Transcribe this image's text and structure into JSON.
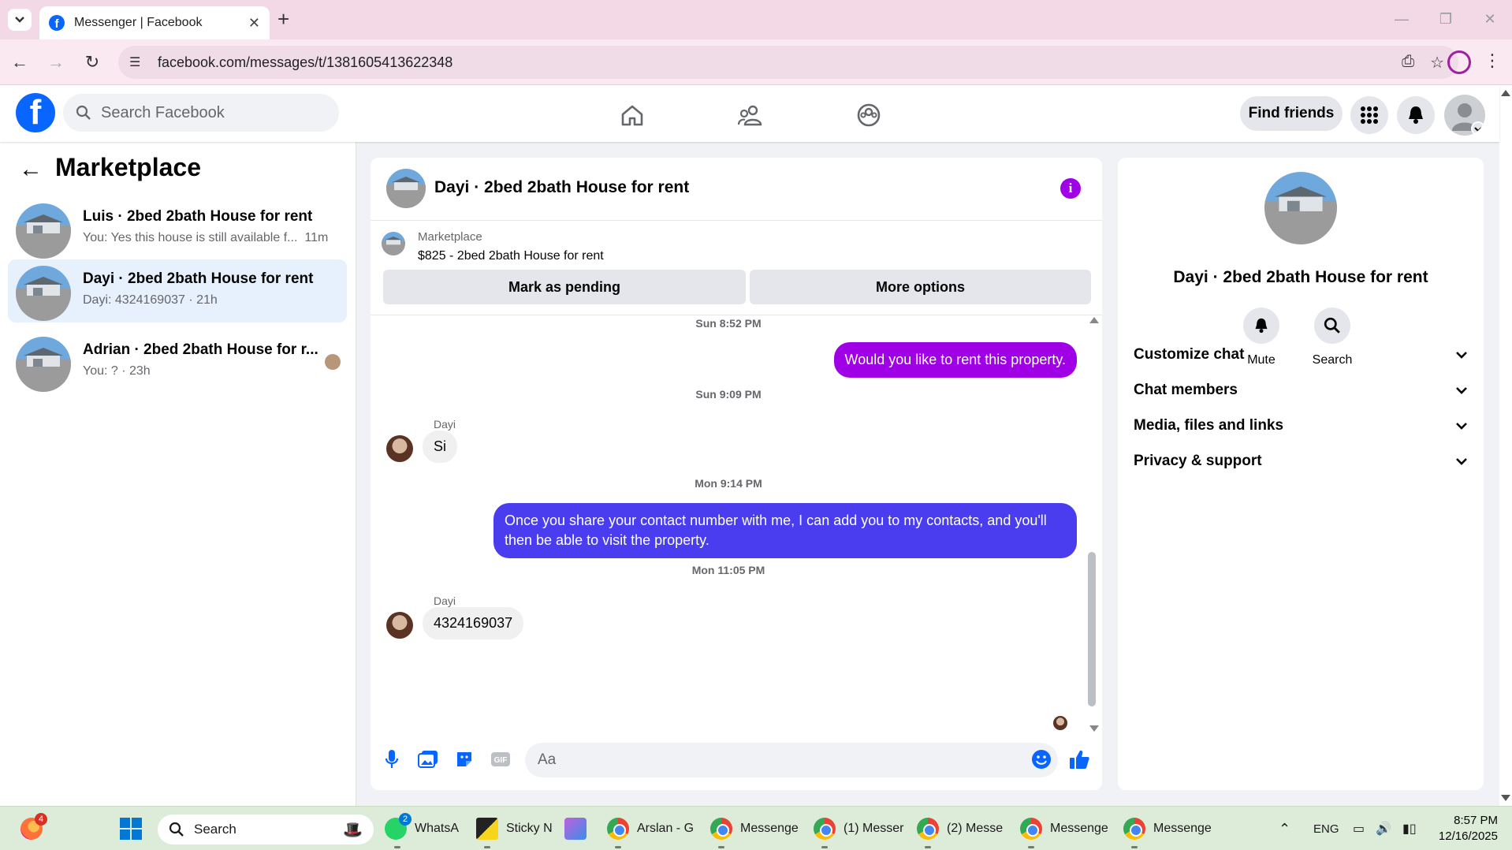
{
  "browser": {
    "tab_title": "Messenger | Facebook",
    "url": "facebook.com/messages/t/1381605413622348"
  },
  "header": {
    "search_placeholder": "Search Facebook",
    "find_friends": "Find friends"
  },
  "sidebar": {
    "title": "Marketplace",
    "conversations": [
      {
        "name": "Luis · 2bed 2bath House for rent",
        "preview": "You: Yes this house is still available f...",
        "time": "11m"
      },
      {
        "name": "Dayi · 2bed 2bath House for rent",
        "preview": "Dayi: 4324169037 · 21h",
        "time": ""
      },
      {
        "name": "Adrian · 2bed 2bath House for r...",
        "preview": "You: ? · 23h",
        "time": ""
      }
    ]
  },
  "chat": {
    "title": "Dayi · 2bed 2bath House for rent",
    "listing_label": "Marketplace",
    "listing_price": "$825 - 2bed 2bath House for rent",
    "mark_pending": "Mark as pending",
    "more_options": "More options",
    "messages": [
      {
        "type": "timestamp",
        "text": "Sun 8:52 PM"
      },
      {
        "type": "outgoing",
        "text": "Would you like to rent this property."
      },
      {
        "type": "timestamp",
        "text": "Sun 9:09 PM"
      },
      {
        "type": "sender",
        "text": "Dayi"
      },
      {
        "type": "incoming",
        "text": "Si"
      },
      {
        "type": "timestamp",
        "text": "Mon 9:14 PM"
      },
      {
        "type": "outgoing",
        "text": "Once you share your contact number with me, I can add you to my contacts, and you'll then be able to visit the property."
      },
      {
        "type": "timestamp",
        "text": "Mon 11:05 PM"
      },
      {
        "type": "sender",
        "text": "Dayi"
      },
      {
        "type": "incoming",
        "text": "4324169037"
      }
    ],
    "input_placeholder": "Aa"
  },
  "info_panel": {
    "name": "Dayi · 2bed 2bath House for rent",
    "mute": "Mute",
    "search": "Search",
    "sections": [
      "Customize chat",
      "Chat members",
      "Media, files and links",
      "Privacy & support"
    ]
  },
  "colors": {
    "brand": "#0866ff",
    "bubble_purple": "#a000e6",
    "bubble_blue": "#4a3df0",
    "selected": "#e7f0fd"
  },
  "taskbar": {
    "search_label": "Search",
    "firefox_badge": "4",
    "whatsapp_badge": "2",
    "apps": [
      "WhatsA",
      "Sticky N",
      "Arslan - G",
      "Messenge",
      "(1) Messer",
      "(2) Messe",
      "Messenge",
      "Messenge"
    ],
    "lang": "ENG",
    "time": "8:57 PM",
    "date": "12/16/2025"
  }
}
